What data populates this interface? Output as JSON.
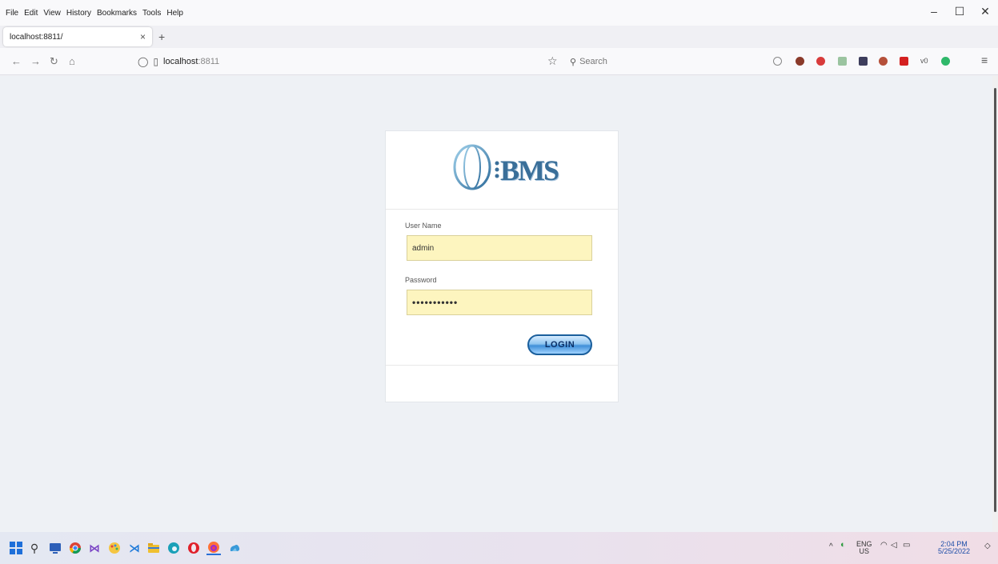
{
  "menubar": {
    "items": [
      "File",
      "Edit",
      "View",
      "History",
      "Bookmarks",
      "Tools",
      "Help"
    ]
  },
  "window_controls": {
    "minimize": "–",
    "maximize": "☐",
    "close": "✕"
  },
  "tab": {
    "title": "localhost:8811/",
    "close": "×",
    "new_tab": "+"
  },
  "navbar": {
    "url_host": "localhost",
    "url_port": ":8811",
    "search_placeholder": "Search"
  },
  "login": {
    "logo_text": "BMS",
    "username_label": "User Name",
    "username_value": "admin",
    "password_label": "Password",
    "password_value": "•••••••••••",
    "login_label": "LOGIN"
  },
  "taskbar": {
    "language_top": "ENG",
    "language_bottom": "US",
    "time": "2:04 PM",
    "date": "5/25/2022"
  },
  "colors": {
    "input_background": "#fdf5bf",
    "login_button_border": "#1b5f9c",
    "logo_color": "#3a6f99",
    "page_background": "#eef1f5"
  }
}
